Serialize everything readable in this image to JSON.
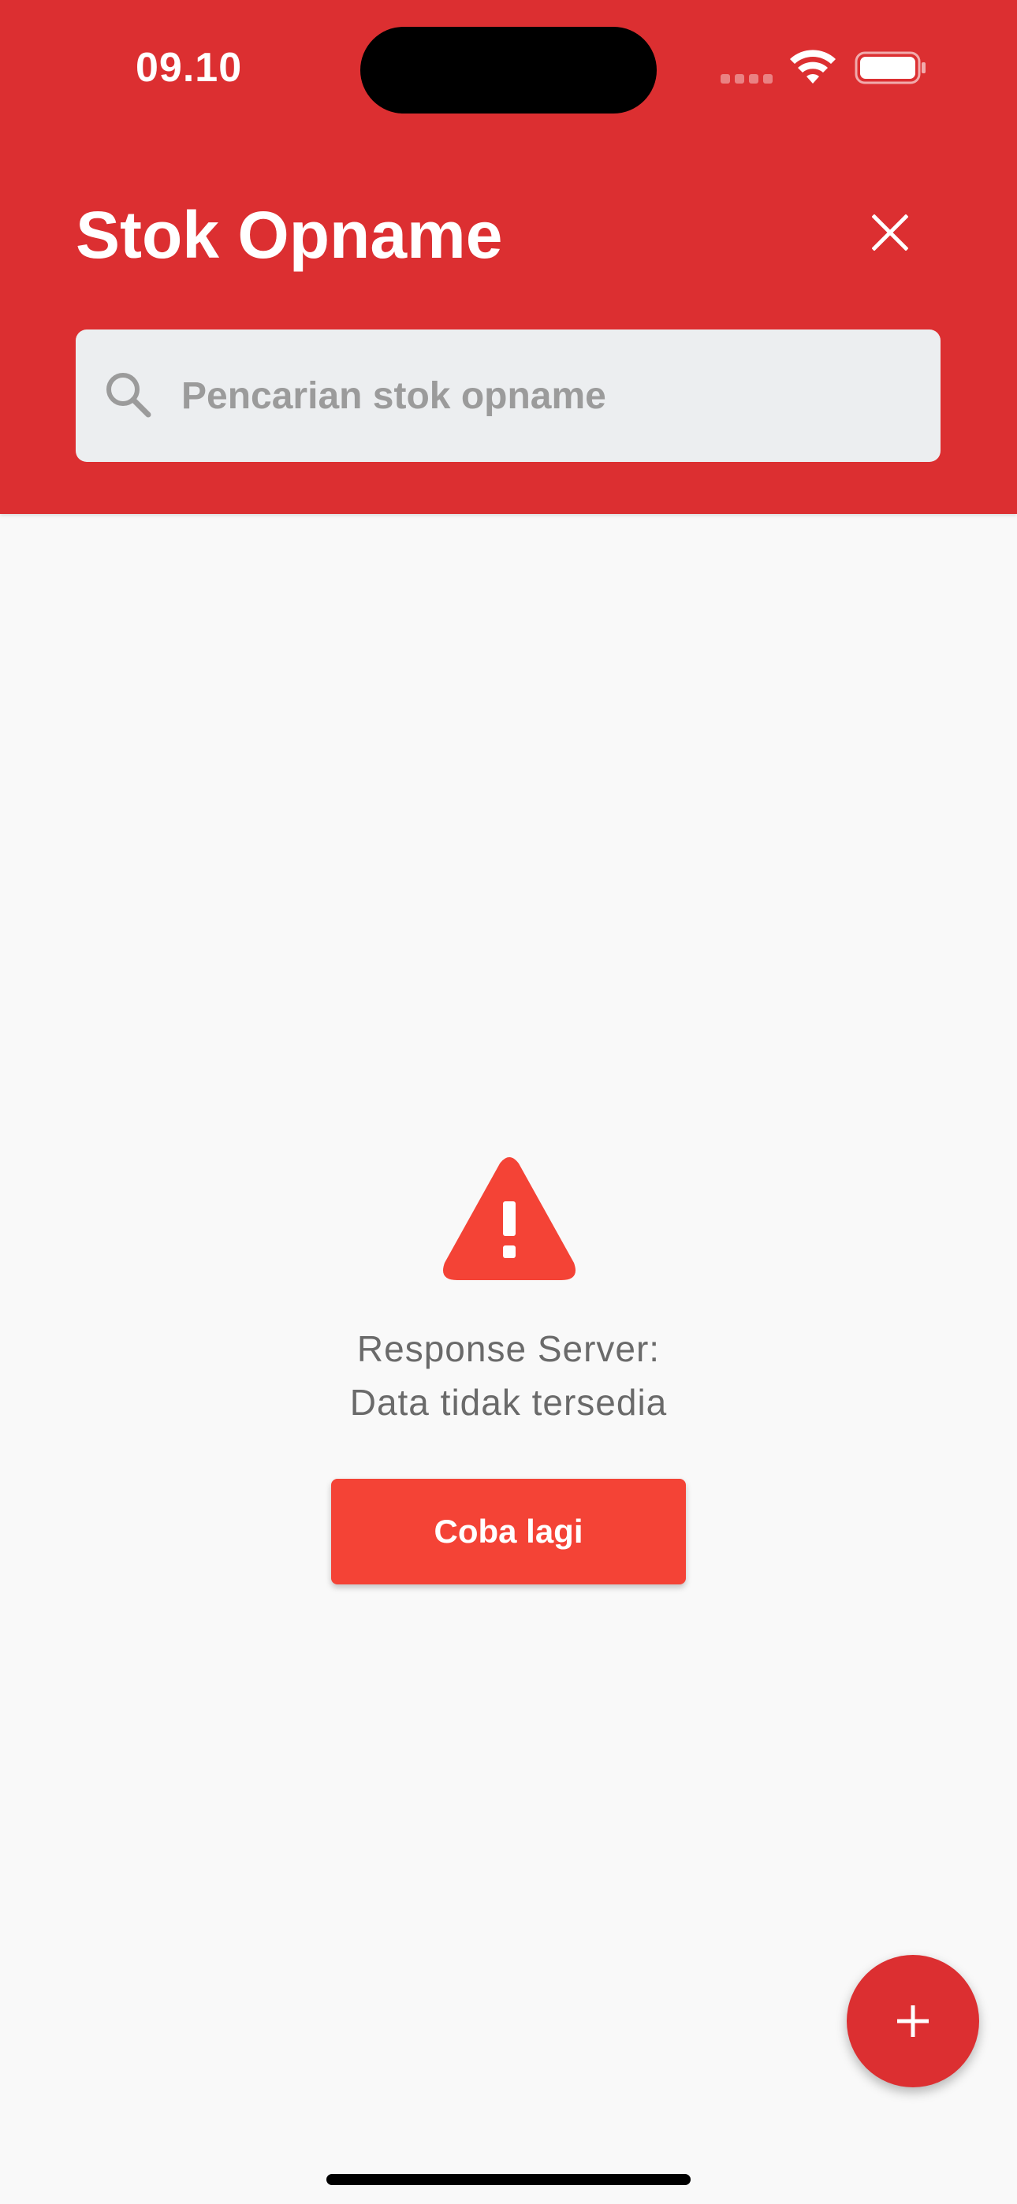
{
  "status_bar": {
    "time": "09.10"
  },
  "header": {
    "title": "Stok Opname",
    "close_icon": "close-icon",
    "background_color": "#dc2f31"
  },
  "search": {
    "placeholder": "Pencarian stok opname",
    "value": "",
    "icon": "search-icon"
  },
  "error_state": {
    "icon": "warning-triangle-icon",
    "icon_color": "#f44336",
    "line1": "Response Server:",
    "line2": "Data tidak tersedia",
    "retry_label": "Coba lagi",
    "retry_color": "#f44336"
  },
  "fab": {
    "icon": "plus-icon",
    "color": "#dc2f31"
  }
}
